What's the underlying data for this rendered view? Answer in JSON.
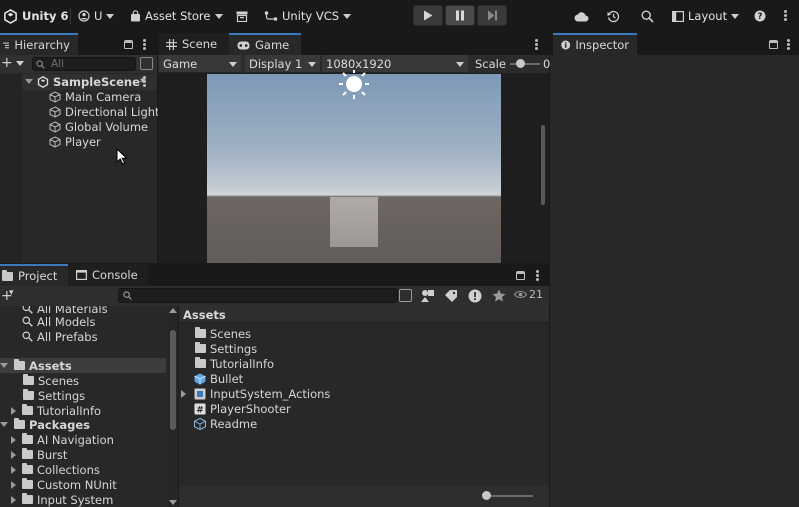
{
  "toolbar": {
    "app_title": "Unity 6",
    "account_label": "U",
    "asset_store_label": "Asset Store",
    "vcs_label": "Unity VCS",
    "layout_label": "Layout"
  },
  "hierarchy": {
    "tab_label": "Hierarchy",
    "search_placeholder": "All",
    "scene_name": "SampleScene*",
    "objects": [
      "Main Camera",
      "Directional Light",
      "Global Volume",
      "Player"
    ]
  },
  "scene_tab": {
    "label": "Scene"
  },
  "game_view": {
    "tab_label": "Game",
    "view_dropdown": "Game",
    "display_dropdown": "Display 1",
    "resolution_dropdown": "1080x1920",
    "scale_label": "Scale",
    "scale_value_partial": "0"
  },
  "inspector": {
    "tab_label": "Inspector"
  },
  "project": {
    "tab_label": "Project",
    "console_tab_label": "Console",
    "filter_count": "21",
    "favorites": [
      "All Materials",
      "All Models",
      "All Prefabs"
    ],
    "assets_root": "Assets",
    "asset_folders": [
      "Scenes",
      "Settings",
      "TutorialInfo"
    ],
    "packages_root": "Packages",
    "packages": [
      "AI Navigation",
      "Burst",
      "Collections",
      "Custom NUnit",
      "Input System"
    ],
    "breadcrumb": "Assets",
    "contents": [
      {
        "name": "Scenes",
        "icon": "folder-icon"
      },
      {
        "name": "Settings",
        "icon": "folder-icon"
      },
      {
        "name": "TutorialInfo",
        "icon": "folder-icon"
      },
      {
        "name": "Bullet",
        "icon": "prefab-icon"
      },
      {
        "name": "InputSystem_Actions",
        "icon": "input-actions-icon"
      },
      {
        "name": "PlayerShooter",
        "icon": "script-icon"
      },
      {
        "name": "Readme",
        "icon": "readme-icon"
      }
    ]
  },
  "colors": {
    "accent": "#3a79bb",
    "panel_bg": "#282828",
    "toolbar_bg": "#191919"
  }
}
